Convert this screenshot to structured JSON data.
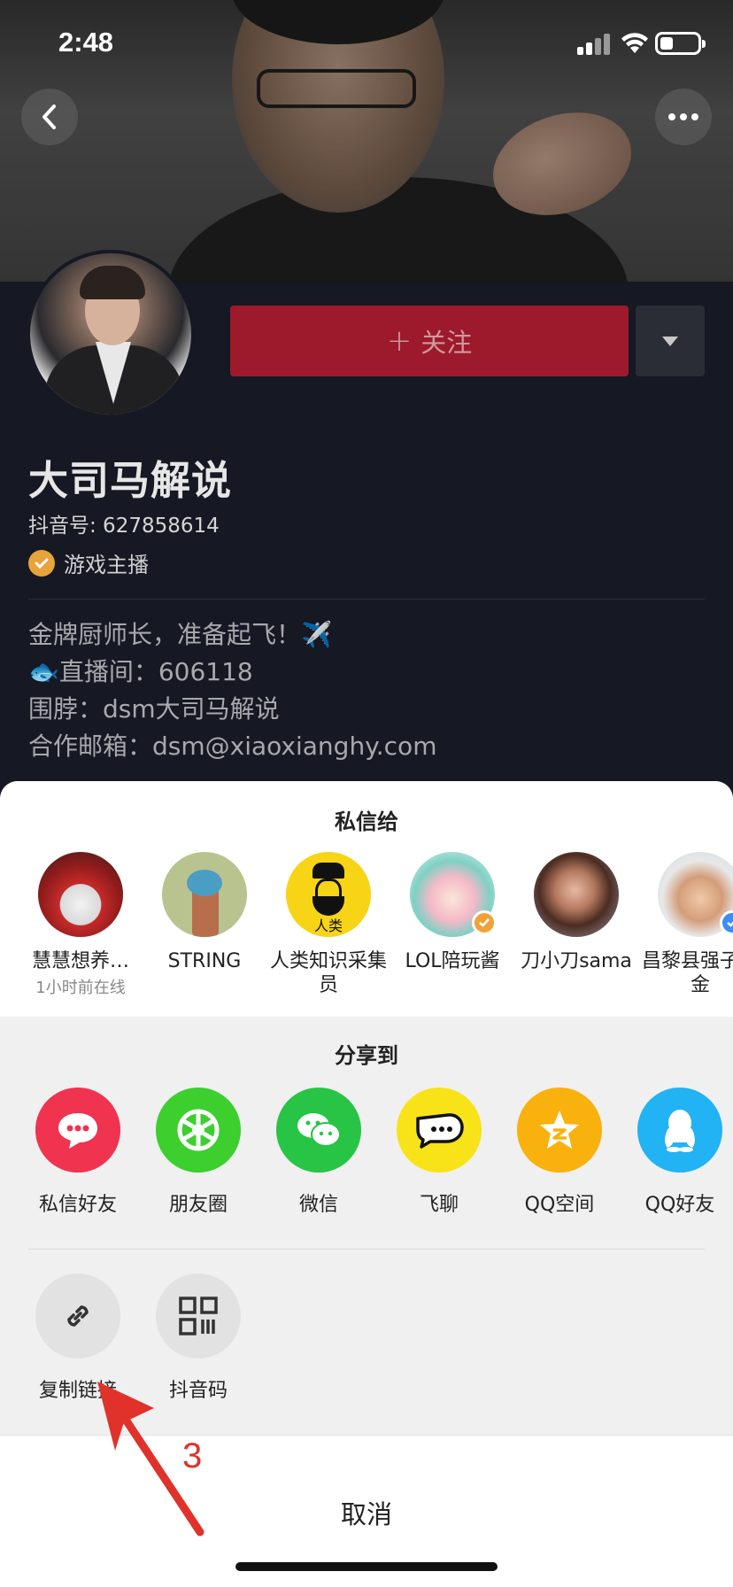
{
  "status_bar": {
    "time": "2:48"
  },
  "header": {
    "back_icon": "chevron-left-icon",
    "more_icon": "ellipsis-icon"
  },
  "profile": {
    "follow_label": "关注",
    "name": "大司马解说",
    "douyin_id": "抖音号: 627858614",
    "verified_label": "游戏主播",
    "bio": [
      "金牌厨师长，准备起飞！✈️",
      "🐟直播间：606118",
      "围脖：dsm大司马解说",
      "合作邮箱：dsm@xiaoxianghy.com"
    ]
  },
  "share_sheet": {
    "dm_title": "私信给",
    "contacts": [
      {
        "name": "慧慧想养…",
        "status": "1小时前在线"
      },
      {
        "name": "STRING"
      },
      {
        "name": "人类知识采集员"
      },
      {
        "name": "LOL陪玩酱"
      },
      {
        "name": "刀小刀sama"
      },
      {
        "name": "昌黎县强子五金"
      }
    ],
    "contact_avatar_text": "人类",
    "share_title": "分享到",
    "apps": [
      {
        "label": "私信好友",
        "color": "#f0334f"
      },
      {
        "label": "朋友圈",
        "color": "#3ccf2e"
      },
      {
        "label": "微信",
        "color": "#28c445"
      },
      {
        "label": "飞聊",
        "color": "#f7e318"
      },
      {
        "label": "QQ空间",
        "color": "#f9b10e"
      },
      {
        "label": "QQ好友",
        "color": "#21b3f3"
      }
    ],
    "tools": [
      {
        "label": "复制链接"
      },
      {
        "label": "抖音码"
      }
    ],
    "cancel_label": "取消"
  },
  "annotation": {
    "number": "3",
    "color": "#e0322a"
  }
}
